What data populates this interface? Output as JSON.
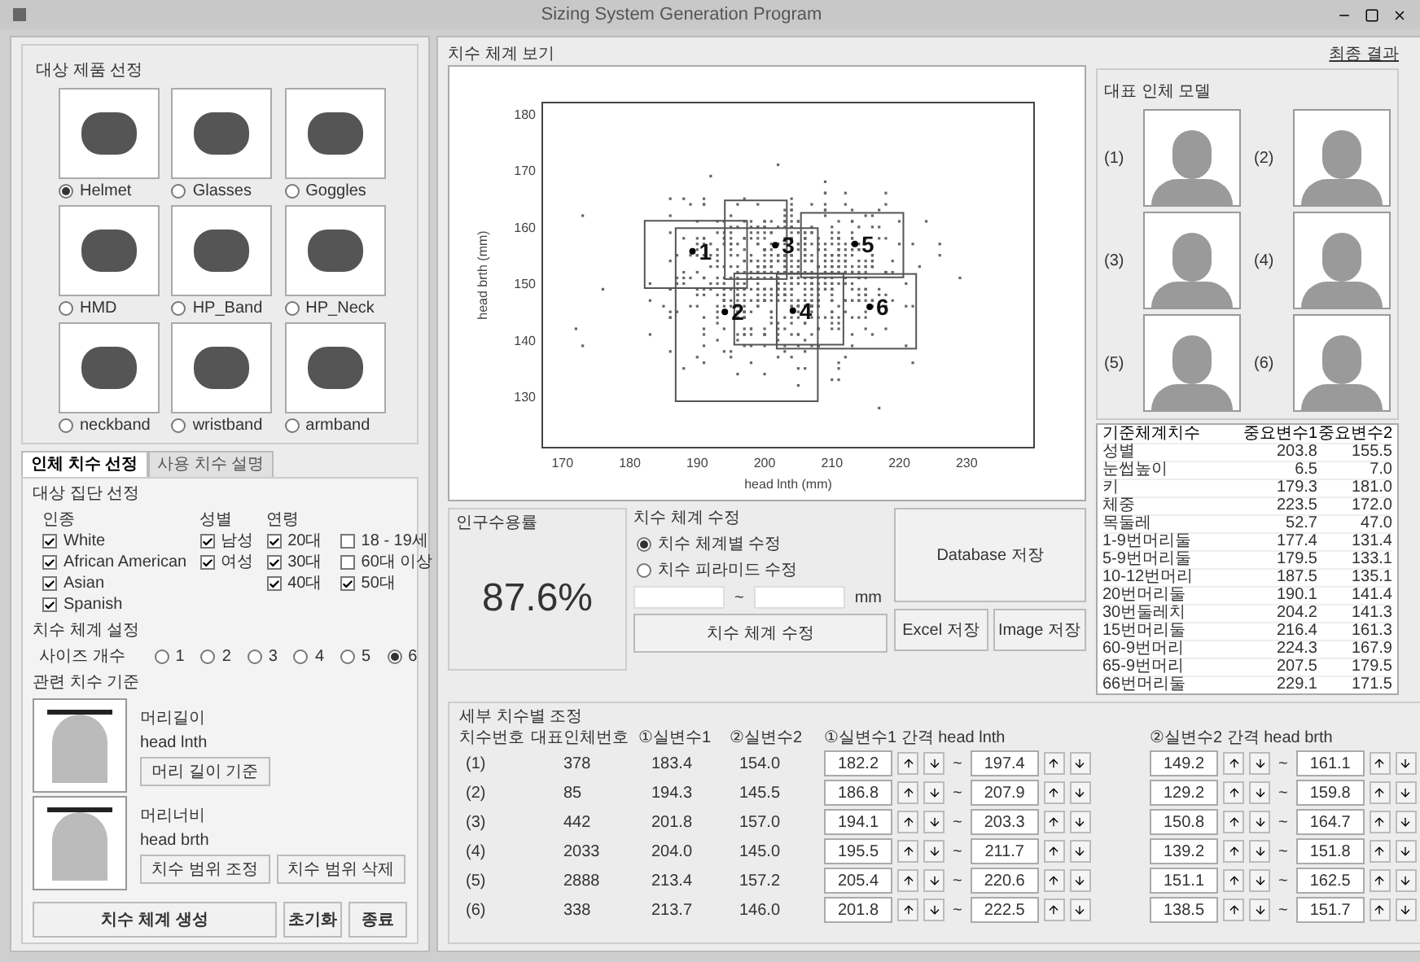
{
  "window": {
    "title": "Sizing System Generation Program"
  },
  "products": {
    "title": "대상 제품 선정",
    "items": [
      {
        "label": "Helmet",
        "selected": true
      },
      {
        "label": "Glasses",
        "selected": false
      },
      {
        "label": "Goggles",
        "selected": false
      },
      {
        "label": "HMD",
        "selected": false
      },
      {
        "label": "HP_Band",
        "selected": false
      },
      {
        "label": "HP_Neck",
        "selected": false
      },
      {
        "label": "neckband",
        "selected": false
      },
      {
        "label": "wristband",
        "selected": false
      },
      {
        "label": "armband",
        "selected": false
      }
    ]
  },
  "tabs": [
    {
      "label": "인체 치수 선정",
      "selected": true
    },
    {
      "label": "사용 치수 설명",
      "selected": false
    }
  ],
  "population": {
    "title": "대상 집단 선정",
    "groups": [
      {
        "title": "인종",
        "options": [
          {
            "label": "White",
            "checked": true
          },
          {
            "label": "African American",
            "checked": true
          },
          {
            "label": "Asian",
            "checked": true
          },
          {
            "label": "Spanish",
            "checked": true
          }
        ]
      },
      {
        "title": "성별",
        "options": [
          {
            "label": "남성",
            "checked": true
          },
          {
            "label": "여성",
            "checked": true
          }
        ]
      },
      {
        "title": "연령",
        "options": [
          {
            "label": "20대",
            "checked": true
          },
          {
            "label": "18 - 19세",
            "checked": false
          },
          {
            "label": "30대",
            "checked": true
          },
          {
            "label": "60대 이상",
            "checked": false
          },
          {
            "label": "40대",
            "checked": true
          },
          {
            "label": "50대",
            "checked": true
          }
        ]
      }
    ]
  },
  "sizing": {
    "title": "치수 체계 설정",
    "label": "사이즈 개수",
    "options": [
      {
        "label": "1",
        "selected": false
      },
      {
        "label": "2",
        "selected": false
      },
      {
        "label": "3",
        "selected": false
      },
      {
        "label": "4",
        "selected": false
      },
      {
        "label": "5",
        "selected": false
      },
      {
        "label": "6",
        "selected": true
      }
    ]
  },
  "dimensions": {
    "title": "관련 치수 기준",
    "items": [
      {
        "name": "머리길이",
        "code": "head lnth",
        "buttons": [
          "머리 길이 기준"
        ]
      },
      {
        "name": "머리너비",
        "code": "head brth",
        "buttons": [
          "치수 범위 조정",
          "치수 범위 삭제"
        ]
      }
    ]
  },
  "left_buttons": [
    "치수 체계 생성",
    "초기화",
    "종료"
  ],
  "chart_panel": {
    "title": "치수 체계 보기",
    "chart_data": {
      "type": "scatter",
      "xlabel": "head lnth (mm)",
      "ylabel": "head brth (mm)",
      "xlim": [
        167,
        240
      ],
      "ylim": [
        121,
        182
      ],
      "xticks": [
        170,
        180,
        190,
        200,
        210,
        220,
        230
      ],
      "yticks": [
        130,
        140,
        150,
        160,
        170,
        180
      ],
      "x": [
        189.3,
        194.1,
        201.6,
        204.2,
        213.4,
        215.6
      ],
      "series": [
        {
          "color": "#000000",
          "values": [
            155.7,
            145.0,
            156.8,
            145.2,
            157.0,
            145.9
          ]
        }
      ],
      "annotations": [
        {
          "text": "1",
          "x": 189.3,
          "y": 155.7
        },
        {
          "text": "2",
          "x": 194.1,
          "y": 145.0
        },
        {
          "text": "3",
          "x": 201.6,
          "y": 156.8
        },
        {
          "text": "4",
          "x": 204.2,
          "y": 145.2
        },
        {
          "text": "5",
          "x": 213.4,
          "y": 157.0
        },
        {
          "text": "6",
          "x": 215.6,
          "y": 145.9
        }
      ]
    }
  },
  "accommodation": {
    "title": "인구수용률",
    "value": "87.6%"
  },
  "modify": {
    "title": "치수 체계 수정",
    "options": [
      {
        "label": "치수 체계별 수정",
        "selected": true
      },
      {
        "label": "치수 피라미드 수정",
        "selected": false
      }
    ],
    "separator": "~",
    "unit": "mm",
    "button": "치수 체계 수정"
  },
  "save_buttons": {
    "database": "Database 저장",
    "excel": "Excel 저장",
    "image": "Image 저장"
  },
  "result_link": "최종 결과",
  "models": {
    "title": "대표 인체 모델",
    "items": [
      "(1)",
      "(2)",
      "(3)",
      "(4)",
      "(5)",
      "(6)"
    ]
  },
  "model_table": {
    "columns": [
      "기준체계치수",
      "중요변수1",
      "중요변수2"
    ],
    "rows": [
      [
        "성별",
        "203.8",
        "155.5"
      ],
      [
        "눈썹높이",
        "6.5",
        "7.0"
      ],
      [
        "키",
        "179.3",
        "181.0"
      ],
      [
        "체중",
        "223.5",
        "172.0"
      ],
      [
        "목둘레",
        "52.7",
        "47.0"
      ],
      [
        "1-9번머리둘",
        "177.4",
        "131.4"
      ],
      [
        "5-9번머리둘",
        "179.5",
        "133.1"
      ],
      [
        "10-12번머리",
        "187.5",
        "135.1"
      ],
      [
        "20번머리둘",
        "190.1",
        "141.4"
      ],
      [
        "30번둘레치",
        "204.2",
        "141.3"
      ],
      [
        "15번머리둘",
        "216.4",
        "161.3"
      ],
      [
        "60-9번머리",
        "224.3",
        "167.9"
      ],
      [
        "65-9번머리",
        "207.5",
        "179.5"
      ],
      [
        "66번머리둘",
        "229.1",
        "171.5"
      ]
    ]
  },
  "detail": {
    "title": "세부 치수별 조정",
    "columns": [
      "치수번호",
      "대표인체번호",
      "①실변수1",
      "②실변수2",
      "①실변수1 간격 head lnth",
      "②실변수2 간격 head brth"
    ],
    "separator": "~",
    "rows": [
      {
        "id": "(1)",
        "model": "378",
        "v1": "183.4",
        "v2": "154.0",
        "r1": [
          "182.2",
          "197.4"
        ],
        "r2": [
          "149.2",
          "161.1"
        ]
      },
      {
        "id": "(2)",
        "model": "85",
        "v1": "194.3",
        "v2": "145.5",
        "r1": [
          "186.8",
          "207.9"
        ],
        "r2": [
          "129.2",
          "159.8"
        ]
      },
      {
        "id": "(3)",
        "model": "442",
        "v1": "201.8",
        "v2": "157.0",
        "r1": [
          "194.1",
          "203.3"
        ],
        "r2": [
          "150.8",
          "164.7"
        ]
      },
      {
        "id": "(4)",
        "model": "2033",
        "v1": "204.0",
        "v2": "145.0",
        "r1": [
          "195.5",
          "211.7"
        ],
        "r2": [
          "139.2",
          "151.8"
        ]
      },
      {
        "id": "(5)",
        "model": "2888",
        "v1": "213.4",
        "v2": "157.2",
        "r1": [
          "205.4",
          "220.6"
        ],
        "r2": [
          "151.1",
          "162.5"
        ]
      },
      {
        "id": "(6)",
        "model": "338",
        "v1": "213.7",
        "v2": "146.0",
        "r1": [
          "201.8",
          "222.5"
        ],
        "r2": [
          "138.5",
          "151.7"
        ]
      }
    ]
  }
}
